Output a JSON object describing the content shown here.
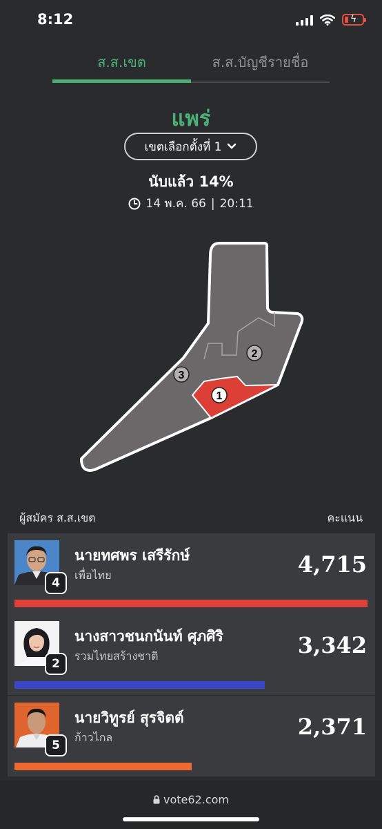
{
  "status_bar": {
    "time": "8:12"
  },
  "tabs": [
    {
      "label": "ส.ส.เขต",
      "active": true
    },
    {
      "label": "ส.ส.บัญชีรายชื่อ",
      "active": false
    }
  ],
  "province": "แพร่",
  "district_select": {
    "label": "เขตเลือกตั้งที่ 1"
  },
  "counted": "นับแล้ว 14%",
  "timestamp": {
    "date": "14 พ.ค. 66",
    "separator": "|",
    "time": "20:11"
  },
  "map": {
    "districts": [
      {
        "number": "1",
        "selected": true
      },
      {
        "number": "2",
        "selected": false
      },
      {
        "number": "3",
        "selected": false
      }
    ],
    "colors": {
      "selected": "#e0443a",
      "region": "#6c6a6b",
      "outline": "#ffffff"
    }
  },
  "list_header": {
    "left": "ผู้สมัคร ส.ส.เขต",
    "right": "คะแนน"
  },
  "candidates": [
    {
      "name": "นายทศพร เสรีรักษ์",
      "party": "เพื่อไทย",
      "number": "4",
      "score": "4,715",
      "votes": 4715,
      "bar_color": "#e0403a"
    },
    {
      "name": "นางสาวชนกนันท์ ศุภศิริ",
      "party": "รวมไทยสร้างชาติ",
      "number": "2",
      "score": "3,342",
      "votes": 3342,
      "bar_color": "#3b45c8"
    },
    {
      "name": "นายวิทูรย์ สุรจิตต์",
      "party": "ก้าวไกล",
      "number": "5",
      "score": "2,371",
      "votes": 2371,
      "bar_color": "#ec6a2f"
    }
  ],
  "url": "vote62.com"
}
